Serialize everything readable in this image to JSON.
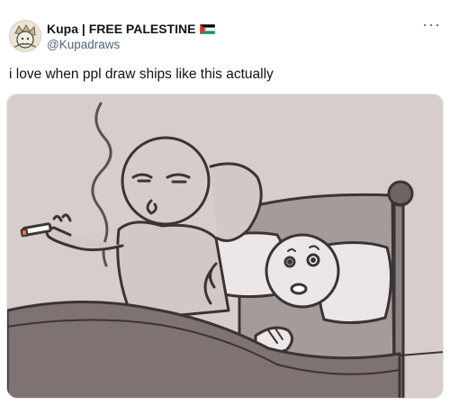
{
  "tweet": {
    "display_name": "Kupa | FREE PALESTINE",
    "flag_icon": "palestine-flag-icon",
    "handle": "@Kupadraws",
    "text": "i love when ppl draw ships like this actually",
    "more_icon": "more-options-icon"
  },
  "media": {
    "kind": "cartoon-illustration"
  },
  "colors": {
    "text_primary": "#0f1419",
    "text_secondary": "#536471",
    "image_background": "#d6cccc",
    "flag_red": "#e4312b",
    "flag_green": "#149954"
  }
}
